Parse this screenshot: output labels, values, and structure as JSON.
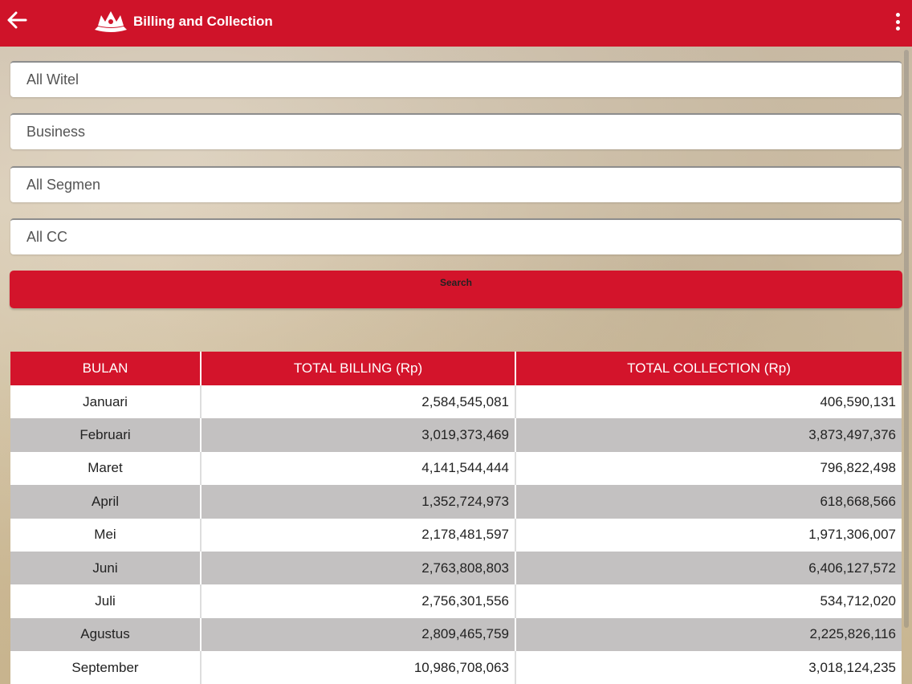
{
  "appbar": {
    "title": "Billing and Collection",
    "back_icon": "arrow-left-icon",
    "logo_icon": "crown-logo-icon",
    "menu_icon": "more-vertical-icon",
    "color": "#cf1329"
  },
  "filters": {
    "witel": "All Witel",
    "business": "Business",
    "segmen": "All Segmen",
    "cc": "All CC"
  },
  "search": {
    "label": "Search"
  },
  "table": {
    "headers": [
      "BULAN",
      "TOTAL BILLING (Rp)",
      "TOTAL COLLECTION (Rp)"
    ],
    "rows": [
      [
        "Januari",
        "2,584,545,081",
        "406,590,131"
      ],
      [
        "Februari",
        "3,019,373,469",
        "3,873,497,376"
      ],
      [
        "Maret",
        "4,141,544,444",
        "796,822,498"
      ],
      [
        "April",
        "1,352,724,973",
        "618,668,566"
      ],
      [
        "Mei",
        "2,178,481,597",
        "1,971,306,007"
      ],
      [
        "Juni",
        "2,763,808,803",
        "6,406,127,572"
      ],
      [
        "Juli",
        "2,756,301,556",
        "534,712,020"
      ],
      [
        "Agustus",
        "2,809,465,759",
        "2,225,826,116"
      ],
      [
        "September",
        "10,986,708,063",
        "3,018,124,235"
      ]
    ]
  }
}
